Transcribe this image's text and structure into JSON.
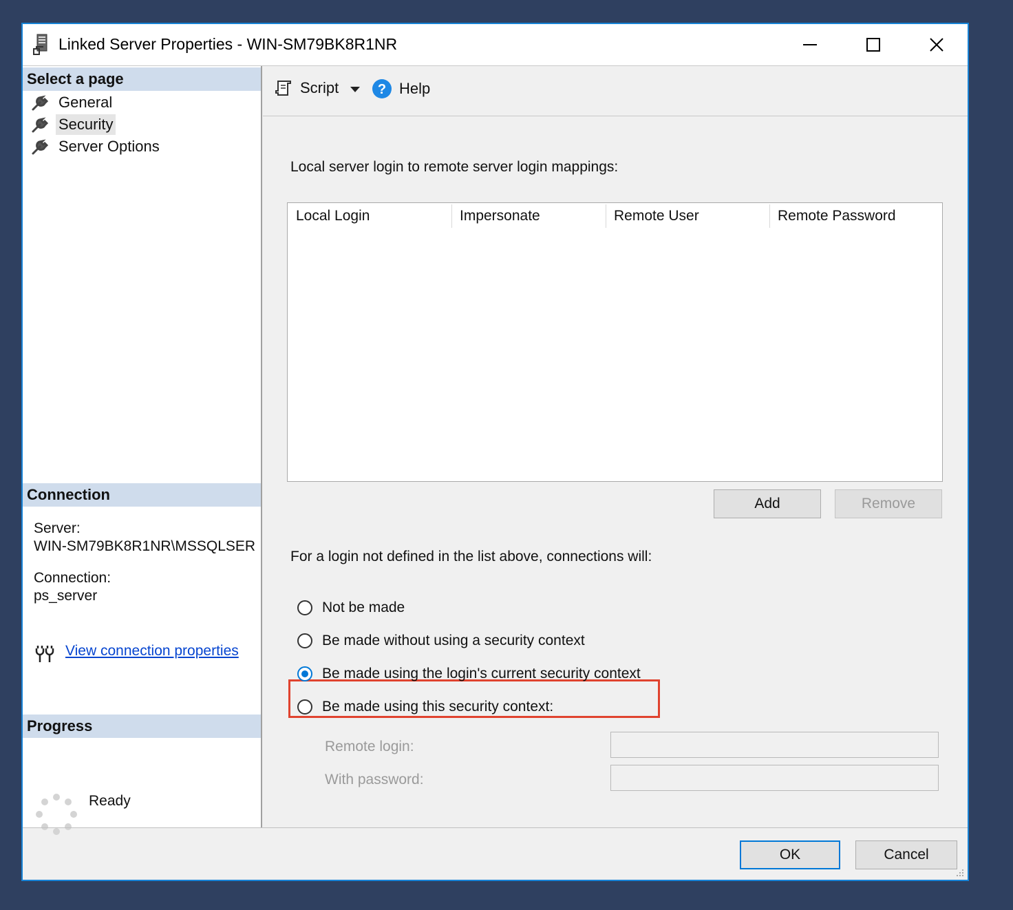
{
  "window": {
    "title": "Linked Server Properties - WIN-SM79BK8R1NR",
    "accent": "#1783d6",
    "buttons": [
      "minimize-icon",
      "maximize-icon",
      "close-icon"
    ]
  },
  "sidebar": {
    "select_page_heading": "Select a page",
    "items": [
      {
        "label": "General",
        "icon": "wrench-icon",
        "selected": false
      },
      {
        "label": "Security",
        "icon": "wrench-icon",
        "selected": true
      },
      {
        "label": "Server Options",
        "icon": "wrench-icon",
        "selected": false
      }
    ],
    "connection_heading": "Connection",
    "server_label": "Server:",
    "server_value": "WIN-SM79BK8R1NR\\MSSQLSER",
    "connection_label": "Connection:",
    "connection_value": "ps_server",
    "view_link": "View connection properties",
    "progress_heading": "Progress",
    "progress_status": "Ready"
  },
  "toolbar": {
    "script_label": "Script",
    "help_label": "Help"
  },
  "security": {
    "mappings_label": "Local server login to remote server login mappings:",
    "columns": [
      "Local Login",
      "Impersonate",
      "Remote User",
      "Remote Password"
    ],
    "rows": [],
    "add_label": "Add",
    "remove_label": "Remove",
    "fallback_label": "For a login not defined in the list above, connections will:",
    "options": [
      {
        "label": "Not be made",
        "selected": false
      },
      {
        "label": "Be made without using a security context",
        "selected": false
      },
      {
        "label": "Be made using the login's current security context",
        "selected": true
      },
      {
        "label": "Be made using this security context:",
        "selected": false
      }
    ],
    "remote_login_label": "Remote login:",
    "remote_login_value": "",
    "password_label": "With password:",
    "password_value": "",
    "highlight_color": "#e0432f"
  },
  "footer": {
    "ok_label": "OK",
    "cancel_label": "Cancel"
  }
}
